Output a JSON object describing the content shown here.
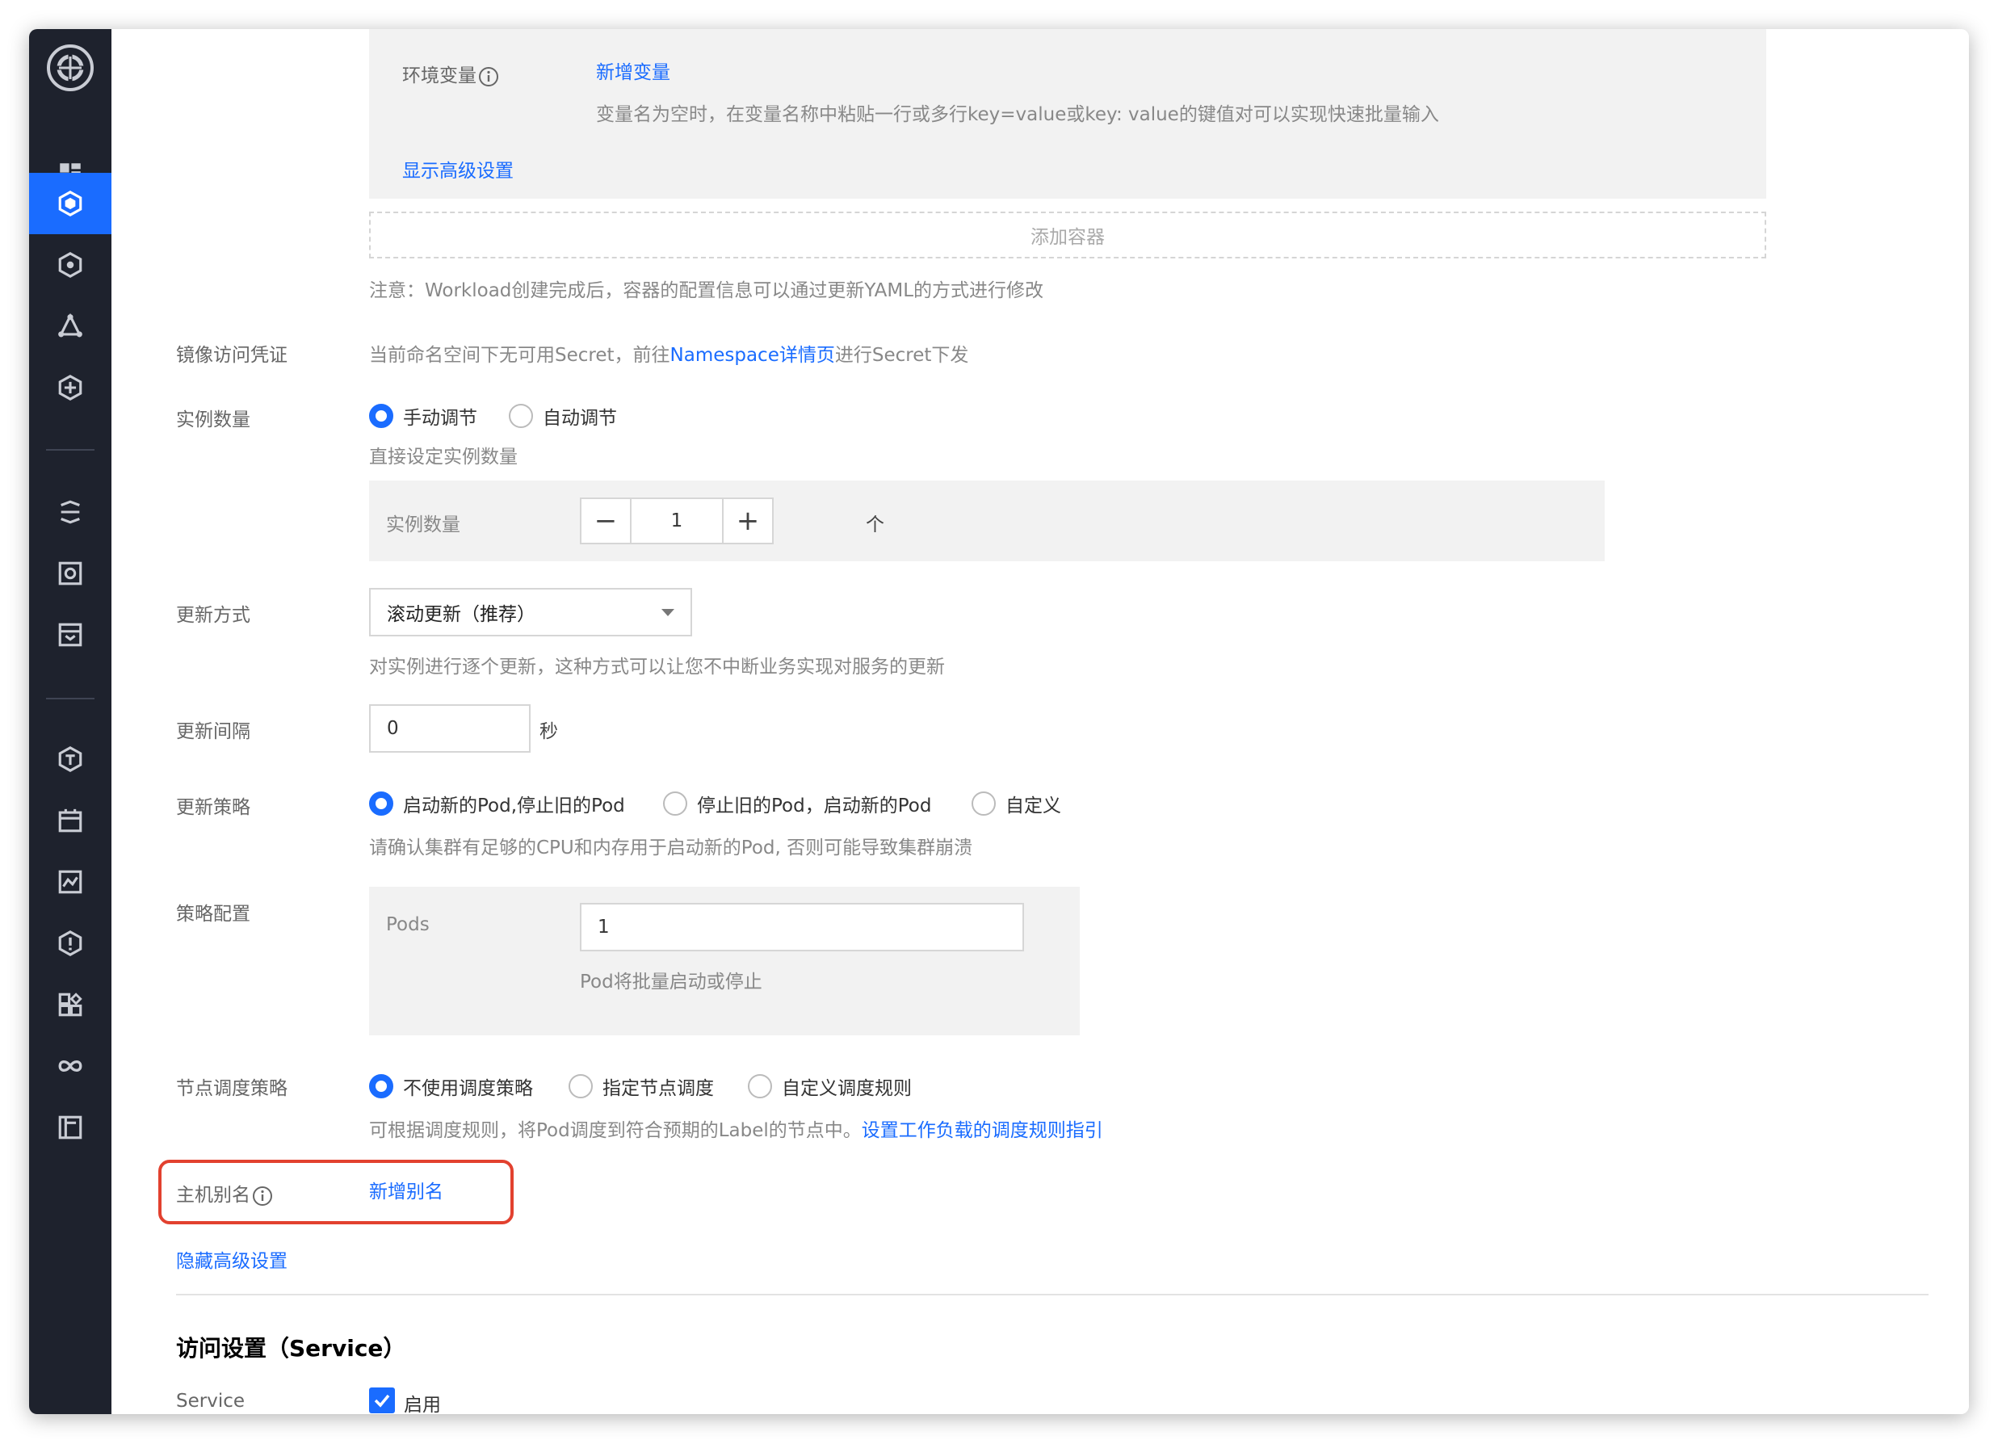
{
  "env": {
    "label": "环境变量",
    "add_link": "新增变量",
    "hint": "变量名为空时，在变量名称中粘贴一行或多行key=value或key: value的键值对可以实现快速批量输入",
    "advanced_link": "显示高级设置"
  },
  "container": {
    "add_label": "添加容器",
    "note": "注意：Workload创建完成后，容器的配置信息可以通过更新YAML的方式进行修改"
  },
  "image_secret": {
    "label": "镜像访问凭证",
    "text_before": "当前命名空间下无可用Secret，前往",
    "link": "Namespace详情页",
    "text_after": "进行Secret下发"
  },
  "replicas": {
    "label": "实例数量",
    "option_manual": "手动调节",
    "option_auto": "自动调节",
    "hint": "直接设定实例数量",
    "inner_label": "实例数量",
    "value": "1",
    "unit": "个",
    "minus": "−",
    "plus": "+"
  },
  "update_method": {
    "label": "更新方式",
    "selected": "滚动更新（推荐）",
    "hint": "对实例进行逐个更新，这种方式可以让您不中断业务实现对服务的更新"
  },
  "update_interval": {
    "label": "更新间隔",
    "value": "0",
    "unit": "秒"
  },
  "update_strategy": {
    "label": "更新策略",
    "option_1": "启动新的Pod,停止旧的Pod",
    "option_2": "停止旧的Pod，启动新的Pod",
    "option_3": "自定义",
    "hint": "请确认集群有足够的CPU和内存用于启动新的Pod, 否则可能导致集群崩溃"
  },
  "strategy_config": {
    "label": "策略配置",
    "pods_label": "Pods",
    "pods_value": "1",
    "hint": "Pod将批量启动或停止"
  },
  "node_scheduling": {
    "label": "节点调度策略",
    "option_1": "不使用调度策略",
    "option_2": "指定节点调度",
    "option_3": "自定义调度规则",
    "hint": "可根据调度规则，将Pod调度到符合预期的Label的节点中。",
    "guide_link": "设置工作负载的调度规则指引"
  },
  "host_alias": {
    "label": "主机别名",
    "add_link": "新增别名"
  },
  "hide_advanced": "隐藏高级设置",
  "access": {
    "title": "访问设置（Service）",
    "service_label": "Service",
    "enable_label": "启用"
  },
  "colors": {
    "accent": "#1a6cff",
    "sidebar_bg": "#1e222d",
    "highlight": "#e2412f"
  },
  "sidebar_icons": [
    "logo-icon",
    "dashboard-icon",
    "cluster-icon",
    "cube-icon",
    "nodes-icon",
    "share-icon",
    "rocket-icon",
    "camera-icon",
    "inbox-icon",
    "tag-icon",
    "calendar-icon",
    "monitor-icon",
    "shield-icon",
    "apps-icon",
    "infinity-icon",
    "book-icon"
  ]
}
